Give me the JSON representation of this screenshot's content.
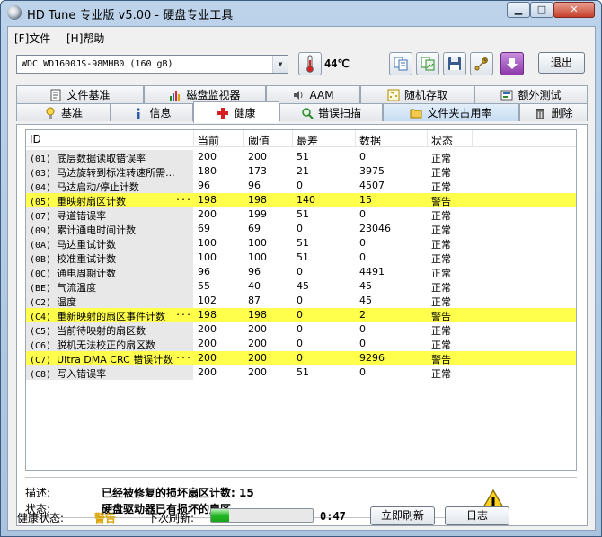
{
  "window": {
    "title": "HD Tune 专业版 v5.00 - 硬盘专业工具"
  },
  "menu": {
    "file": "[F]文件",
    "help": "[H]帮助"
  },
  "toolbar": {
    "drive": "WDC WD1600JS-98MHB0 (160 gB)",
    "temperature": "44℃",
    "exit_label": "退出"
  },
  "tabs_top": [
    {
      "label": "文件基准",
      "icon": "file-benchmark-icon"
    },
    {
      "label": "磁盘监视器",
      "icon": "disk-monitor-icon"
    },
    {
      "label": "AAM",
      "icon": "speaker-icon"
    },
    {
      "label": "随机存取",
      "icon": "random-access-icon"
    },
    {
      "label": "额外测试",
      "icon": "extra-tests-icon"
    }
  ],
  "tabs_bottom": [
    {
      "label": "基准",
      "icon": "benchmark-icon"
    },
    {
      "label": "信息",
      "icon": "info-icon"
    },
    {
      "label": "健康",
      "icon": "health-cross-icon",
      "active": true
    },
    {
      "label": "错误扫描",
      "icon": "magnifier-icon"
    },
    {
      "label": "文件夹占用率",
      "icon": "folder-icon"
    },
    {
      "label": "删除",
      "icon": "trash-icon"
    }
  ],
  "table": {
    "headers": {
      "id": "ID",
      "current": "当前",
      "threshold": "阈值",
      "worst": "最差",
      "data": "数据",
      "status": "状态"
    },
    "rows": [
      {
        "code": "(01)",
        "name": "底层数据读取错误率",
        "current": "200",
        "threshold": "200",
        "worst": "51",
        "data": "0",
        "status": "正常",
        "warn": false
      },
      {
        "code": "(03)",
        "name": "马达旋转到标准转速所需...",
        "current": "180",
        "threshold": "173",
        "worst": "21",
        "data": "3975",
        "status": "正常",
        "warn": false
      },
      {
        "code": "(04)",
        "name": "马达启动/停止计数",
        "current": "96",
        "threshold": "96",
        "worst": "0",
        "data": "4507",
        "status": "正常",
        "warn": false
      },
      {
        "code": "(05)",
        "name": "重映射扇区计数",
        "current": "198",
        "threshold": "198",
        "worst": "140",
        "data": "15",
        "status": "警告",
        "warn": true
      },
      {
        "code": "(07)",
        "name": "寻道错误率",
        "current": "200",
        "threshold": "199",
        "worst": "51",
        "data": "0",
        "status": "正常",
        "warn": false
      },
      {
        "code": "(09)",
        "name": "累计通电时间计数",
        "current": "69",
        "threshold": "69",
        "worst": "0",
        "data": "23046",
        "status": "正常",
        "warn": false
      },
      {
        "code": "(0A)",
        "name": "马达重试计数",
        "current": "100",
        "threshold": "100",
        "worst": "51",
        "data": "0",
        "status": "正常",
        "warn": false
      },
      {
        "code": "(0B)",
        "name": "校准重试计数",
        "current": "100",
        "threshold": "100",
        "worst": "51",
        "data": "0",
        "status": "正常",
        "warn": false
      },
      {
        "code": "(0C)",
        "name": "通电周期计数",
        "current": "96",
        "threshold": "96",
        "worst": "0",
        "data": "4491",
        "status": "正常",
        "warn": false
      },
      {
        "code": "(BE)",
        "name": "气流温度",
        "current": "55",
        "threshold": "40",
        "worst": "45",
        "data": "45",
        "status": "正常",
        "warn": false
      },
      {
        "code": "(C2)",
        "name": "温度",
        "current": "102",
        "threshold": "87",
        "worst": "0",
        "data": "45",
        "status": "正常",
        "warn": false
      },
      {
        "code": "(C4)",
        "name": "重新映射的扇区事件计数",
        "current": "198",
        "threshold": "198",
        "worst": "0",
        "data": "2",
        "status": "警告",
        "warn": true
      },
      {
        "code": "(C5)",
        "name": "当前待映射的扇区数",
        "current": "200",
        "threshold": "200",
        "worst": "0",
        "data": "0",
        "status": "正常",
        "warn": false
      },
      {
        "code": "(C6)",
        "name": "脱机无法校正的扇区数",
        "current": "200",
        "threshold": "200",
        "worst": "0",
        "data": "0",
        "status": "正常",
        "warn": false
      },
      {
        "code": "(C7)",
        "name": "Ultra DMA CRC 错误计数",
        "current": "200",
        "threshold": "200",
        "worst": "0",
        "data": "9296",
        "status": "警告",
        "warn": true
      },
      {
        "code": "(C8)",
        "name": "写入错误率",
        "current": "200",
        "threshold": "200",
        "worst": "51",
        "data": "0",
        "status": "正常",
        "warn": false
      }
    ]
  },
  "description": {
    "desc_label": "描述:",
    "desc_value": "已经被修复的损坏扇区计数: 15",
    "status_label": "状态:",
    "status_value": "硬盘驱动器已有损坏的扇区。"
  },
  "statusbar": {
    "health_label": "健康状态:",
    "health_value": "警告",
    "refresh_label": "下次刷新:",
    "progress": 0.18,
    "time": "0:47",
    "refresh_button": "立即刷新",
    "log_button": "日志"
  },
  "colors": {
    "warning_row": "#ffff4c",
    "health_warning_text": "#d9a300",
    "progress_fill": "#22b823"
  }
}
